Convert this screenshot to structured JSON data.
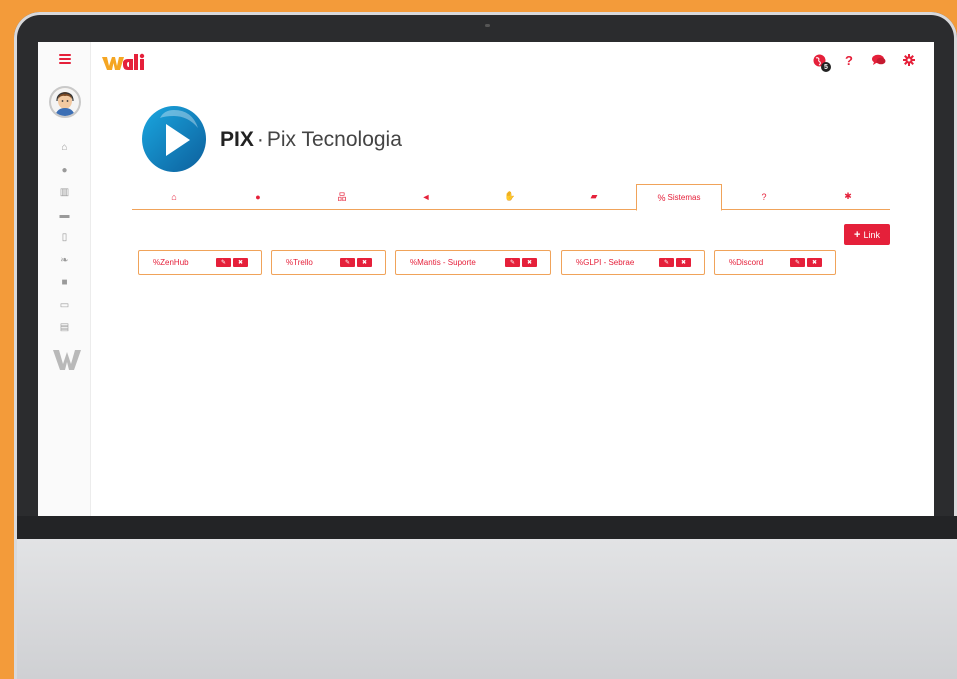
{
  "app": {
    "brand": "wali",
    "badge_count": "5"
  },
  "colors": {
    "accent": "#e5203a",
    "tab_border": "#f0a35a",
    "background": "#f39b3a"
  },
  "sidebar": {
    "items": [
      {
        "icon": "home-icon",
        "glyph": "⌂"
      },
      {
        "icon": "user-icon",
        "glyph": "●"
      },
      {
        "icon": "bank-icon",
        "glyph": "▥"
      },
      {
        "icon": "truck-icon",
        "glyph": "▬"
      },
      {
        "icon": "tablet-icon",
        "glyph": "▯"
      },
      {
        "icon": "leaf-icon",
        "glyph": "❧"
      },
      {
        "icon": "video-icon",
        "glyph": "■"
      },
      {
        "icon": "calendar-icon",
        "glyph": "▭"
      },
      {
        "icon": "file-icon",
        "glyph": "▤"
      }
    ]
  },
  "company": {
    "code": "PIX",
    "separator": "·",
    "name": "Pix Tecnologia"
  },
  "tabs": [
    {
      "icon": "home-icon",
      "glyph": "⌂",
      "label": ""
    },
    {
      "icon": "user-icon",
      "glyph": "●",
      "label": ""
    },
    {
      "icon": "sitemap-icon",
      "glyph": "品",
      "label": ""
    },
    {
      "icon": "bullhorn-icon",
      "glyph": "◄",
      "label": ""
    },
    {
      "icon": "handshake-icon",
      "glyph": "✋",
      "label": ""
    },
    {
      "icon": "book-icon",
      "glyph": "▰",
      "label": ""
    },
    {
      "icon": "link-icon",
      "glyph": "%",
      "label": "Sistemas"
    },
    {
      "icon": "question-icon",
      "glyph": "?",
      "label": ""
    },
    {
      "icon": "gear-icon",
      "glyph": "✱",
      "label": ""
    }
  ],
  "link_button": {
    "glyph": "+",
    "label": "Link"
  },
  "systems": [
    {
      "name": "ZenHub"
    },
    {
      "name": "Trello"
    },
    {
      "name": "Mantis - Suporte"
    },
    {
      "name": "GLPI - Sebrae"
    },
    {
      "name": "Discord"
    }
  ],
  "actions": {
    "edit_glyph": "✎",
    "delete_glyph": "✖",
    "link_glyph": "%"
  }
}
